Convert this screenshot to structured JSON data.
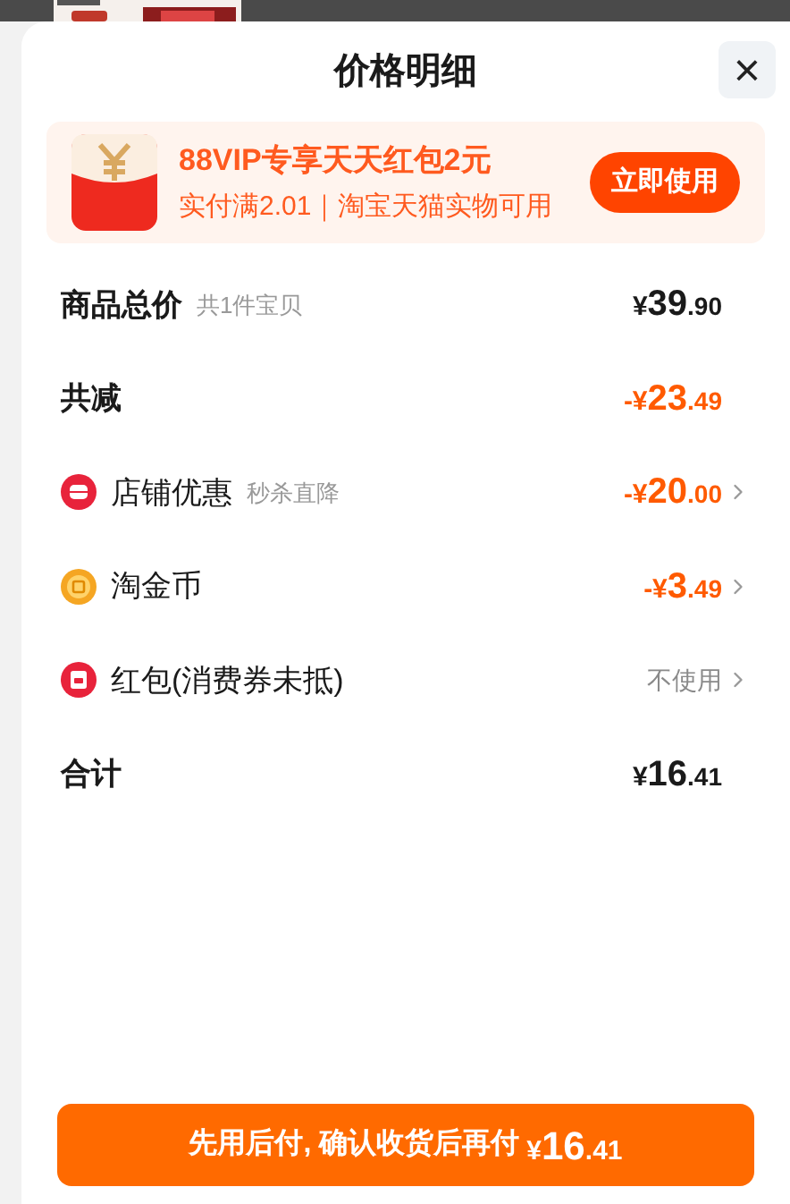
{
  "sheet": {
    "title": "价格明细",
    "close": "×"
  },
  "promo": {
    "title": "88VIP专享天天红包2元",
    "subtitle": "实付满2.01｜淘宝天猫实物可用",
    "button": "立即使用"
  },
  "rows": [
    {
      "kind": "plain",
      "label": "商品总价",
      "note": "共1件宝贝",
      "price": {
        "currency": "¥",
        "whole": "39",
        "fraction": ".90"
      },
      "highlight": false,
      "chevron": false
    },
    {
      "kind": "plain",
      "label": "共减",
      "price": {
        "currency": "-¥",
        "whole": "23",
        "fraction": ".49"
      },
      "highlight": true,
      "chevron": false
    },
    {
      "kind": "store",
      "label": "店铺优惠",
      "note": "秒杀直降",
      "price": {
        "currency": "-¥",
        "whole": "20",
        "fraction": ".00"
      },
      "highlight": true,
      "chevron": true
    },
    {
      "kind": "coin",
      "label": "淘金币",
      "price": {
        "currency": "-¥",
        "whole": "3",
        "fraction": ".49"
      },
      "highlight": true,
      "chevron": true
    },
    {
      "kind": "packet",
      "label": "红包(消费券未抵)",
      "value": "不使用",
      "chevron": true
    },
    {
      "kind": "plain",
      "label": "合计",
      "price": {
        "currency": "¥",
        "whole": "16",
        "fraction": ".41"
      },
      "highlight": false,
      "chevron": false
    }
  ],
  "pay_button": {
    "label": "先用后付, 确认收货后再付",
    "price": {
      "currency": "¥",
      "whole": "16",
      "fraction": ".41"
    }
  }
}
